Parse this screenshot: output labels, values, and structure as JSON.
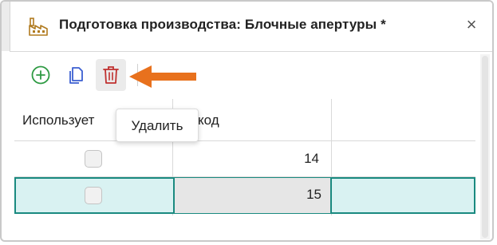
{
  "tab": {
    "title": "Подготовка производства: Блочные апертуры *",
    "close": "×",
    "icon": "factory-icon"
  },
  "toolbar": {
    "add_icon": "plus-circle-icon",
    "copy_icon": "copy-icon",
    "delete_icon": "trash-icon",
    "tooltip": "Удалить"
  },
  "grid": {
    "columns": [
      "Использует",
      "Код"
    ],
    "rows": [
      {
        "uses": false,
        "code": "14",
        "selected": false
      },
      {
        "uses": false,
        "code": "15",
        "selected": true
      }
    ]
  },
  "colors": {
    "accent_arrow": "#e8711d",
    "add_green": "#2e9a43",
    "copy_blue": "#3b5fd1",
    "delete_red": "#c0302f",
    "selected_row_bg": "#d9f2f2",
    "selected_border": "#1a8a80"
  }
}
